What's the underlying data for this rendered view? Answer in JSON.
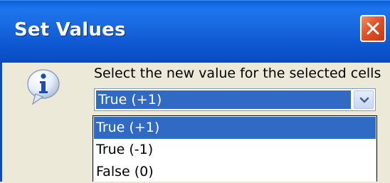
{
  "dialog": {
    "title": "Set Values",
    "close_icon": "close-icon",
    "message_icon": "info-icon",
    "prompt": "Select the new value for the selected cells"
  },
  "combo": {
    "selected_value": "True (+1)",
    "arrow_icon": "chevron-down-icon"
  },
  "dropdown": {
    "options": [
      {
        "label": "True (+1)",
        "selected": true
      },
      {
        "label": "True (-1)",
        "selected": false
      },
      {
        "label": "False (0)",
        "selected": false
      }
    ]
  },
  "colors": {
    "titlebar": "#0a5fd6",
    "selection": "#316ac5",
    "close_button": "#e0532a",
    "dialog_body": "#ece9d8"
  }
}
